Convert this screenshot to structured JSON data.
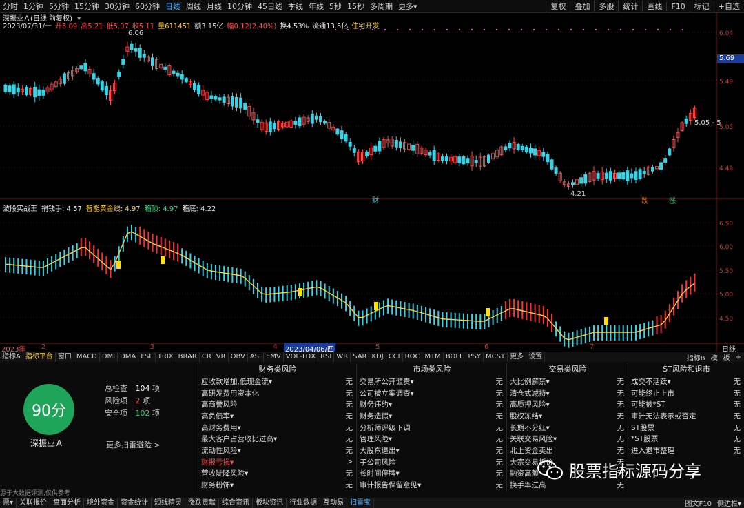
{
  "toolbar": {
    "periods": [
      "分时",
      "1分钟",
      "5分钟",
      "15分钟",
      "30分钟",
      "60分钟",
      "日线",
      "周线",
      "月线",
      "10分钟",
      "45日线",
      "季线",
      "年线",
      "5秒",
      "15秒",
      "多周期",
      "更多▾"
    ],
    "active_period": "日线",
    "right_buttons": [
      "复权",
      "叠加",
      "多股",
      "统计",
      "画线",
      "F10",
      "标记",
      "+自选"
    ]
  },
  "stock": {
    "title": "深振业Ａ(日线 前复权)",
    "info_line": [
      {
        "t": "2023/07/31/一",
        "c": "wht"
      },
      {
        "t": "开5.09",
        "c": "red"
      },
      {
        "t": "高5.21",
        "c": "red"
      },
      {
        "t": "低5.07",
        "c": "red"
      },
      {
        "t": "收5.11",
        "c": "red"
      },
      {
        "t": "量611451",
        "c": "yel"
      },
      {
        "t": "额3.15亿",
        "c": "wht"
      },
      {
        "t": "幅0.12(2.40%)",
        "c": "red"
      },
      {
        "t": "换4.53%",
        "c": "wht"
      },
      {
        "t": "流通13.5亿",
        "c": "wht"
      },
      {
        "t": "住宅开发",
        "c": "yel"
      }
    ],
    "high_label": "6.06",
    "low_label": "4.21",
    "last_label": "5.05 - 5",
    "current_price": "5.69",
    "event_markers": [
      "财",
      "跌",
      "涨"
    ]
  },
  "indicator": {
    "line": [
      {
        "t": "波段实战王",
        "c": "wht"
      },
      {
        "t": "捐钱手: 4.57",
        "c": "wht"
      },
      {
        "t": "智能黄金线: 4.97",
        "c": "yel"
      },
      {
        "t": "箱顶: 4.97",
        "c": "grn"
      },
      {
        "t": "箱底: 4.22",
        "c": "wht"
      }
    ]
  },
  "date_axis": [
    "2023年",
    "2",
    "3",
    "4",
    "2023/04/06/四",
    "5",
    "6",
    "7",
    "日线"
  ],
  "tabs": [
    "指标A",
    "指标平台",
    "窗口",
    "MACD",
    "DMI",
    "DMA",
    "FSL",
    "TRIX",
    "BRAR",
    "CR",
    "VR",
    "OBV",
    "ASI",
    "EMV",
    "VOL-TDX",
    "RSI",
    "WR",
    "SAR",
    "KDJ",
    "CCI",
    "ROC",
    "MTM",
    "BOLL",
    "PSY",
    "MCST",
    "更多",
    "设置"
  ],
  "tabs_active": "指标平台",
  "tabs_right": [
    "指标B",
    "模",
    "板",
    "+"
  ],
  "risk": {
    "score": "90分",
    "name": "深振业Ａ",
    "total_label": "总检查",
    "total_value": "104",
    "total_unit": "项",
    "risk_label": "风险项",
    "risk_value": "2",
    "risk_unit": "项",
    "safe_label": "安全项",
    "safe_value": "102",
    "safe_unit": "项",
    "more": "更多扫雷避险 >",
    "disclaimer": "源于大数据评测,仅供参考",
    "columns": [
      {
        "title": "财务类风险",
        "items": [
          [
            "应收款增加,低现金流▾",
            "无"
          ],
          [
            "高研发费用资本化",
            "无"
          ],
          [
            "高商誉风险",
            "无"
          ],
          [
            "高负债率▾",
            "无"
          ],
          [
            "高财务费用▾",
            "无"
          ],
          [
            "最大客户占营收比过高▾",
            "无"
          ],
          [
            "流动性风险▾",
            "无"
          ],
          [
            "财报亏损▾",
            ">"
          ],
          [
            "营收陡降风险▾",
            "无"
          ],
          [
            "财务粉饰▾",
            "无"
          ]
        ]
      },
      {
        "title": "市场类风险",
        "items": [
          [
            "交易所公开谴责▾",
            "无"
          ],
          [
            "公司被立案调查▾",
            "无"
          ],
          [
            "财务违约▾",
            "无"
          ],
          [
            "财务造假▾",
            "无"
          ],
          [
            "分析师评级下调",
            "无"
          ],
          [
            "管理风险▾",
            "无"
          ],
          [
            "大股东退出▾",
            "无"
          ],
          [
            "子公司风险",
            "无"
          ],
          [
            "长时间停牌▾",
            "无"
          ],
          [
            "审计报告保留意见▾",
            "无"
          ]
        ]
      },
      {
        "title": "交易类风险",
        "items": [
          [
            "大比例解禁▾",
            "无"
          ],
          [
            "清仓式减持▾",
            "无"
          ],
          [
            "高质押风险▾",
            "无"
          ],
          [
            "股权冻结▾",
            "无"
          ],
          [
            "长期不分红▾",
            "无"
          ],
          [
            "关联交易风险▾",
            "无"
          ],
          [
            "北上资金卖出",
            "无"
          ],
          [
            "大宗交易折价",
            "无"
          ],
          [
            "融资高额",
            "无"
          ],
          [
            "换手率过高",
            "无"
          ]
        ]
      },
      {
        "title": "ST风险和退市",
        "items": [
          [
            "成交不活跃▾",
            "无"
          ],
          [
            "可能终止上市",
            "无"
          ],
          [
            "可能被*ST",
            "无"
          ],
          [
            "审计无法表示或否定",
            "无"
          ],
          [
            "ST股票",
            "无"
          ],
          [
            "*ST股票",
            "无"
          ],
          [
            "进入退市整理",
            "无"
          ]
        ]
      }
    ]
  },
  "bottom_nav": [
    "票▾",
    "关联报价",
    "盘面分析",
    "境外资金",
    "资金统计",
    "短线精灵",
    "涨跌贡献",
    "综合资讯",
    "板块资讯",
    "行业数据",
    "互动易",
    "扫雷宝"
  ],
  "bottom_nav_active": "扫雷宝",
  "bottom_right": [
    "图文F10",
    "侧边栏▾"
  ],
  "watermark": "股票指标源码分享",
  "colors": {
    "up": "#ff4a4a",
    "down": "#39d3e6",
    "yellow": "#ffd23a",
    "score_bg": "#1fa55a"
  }
}
